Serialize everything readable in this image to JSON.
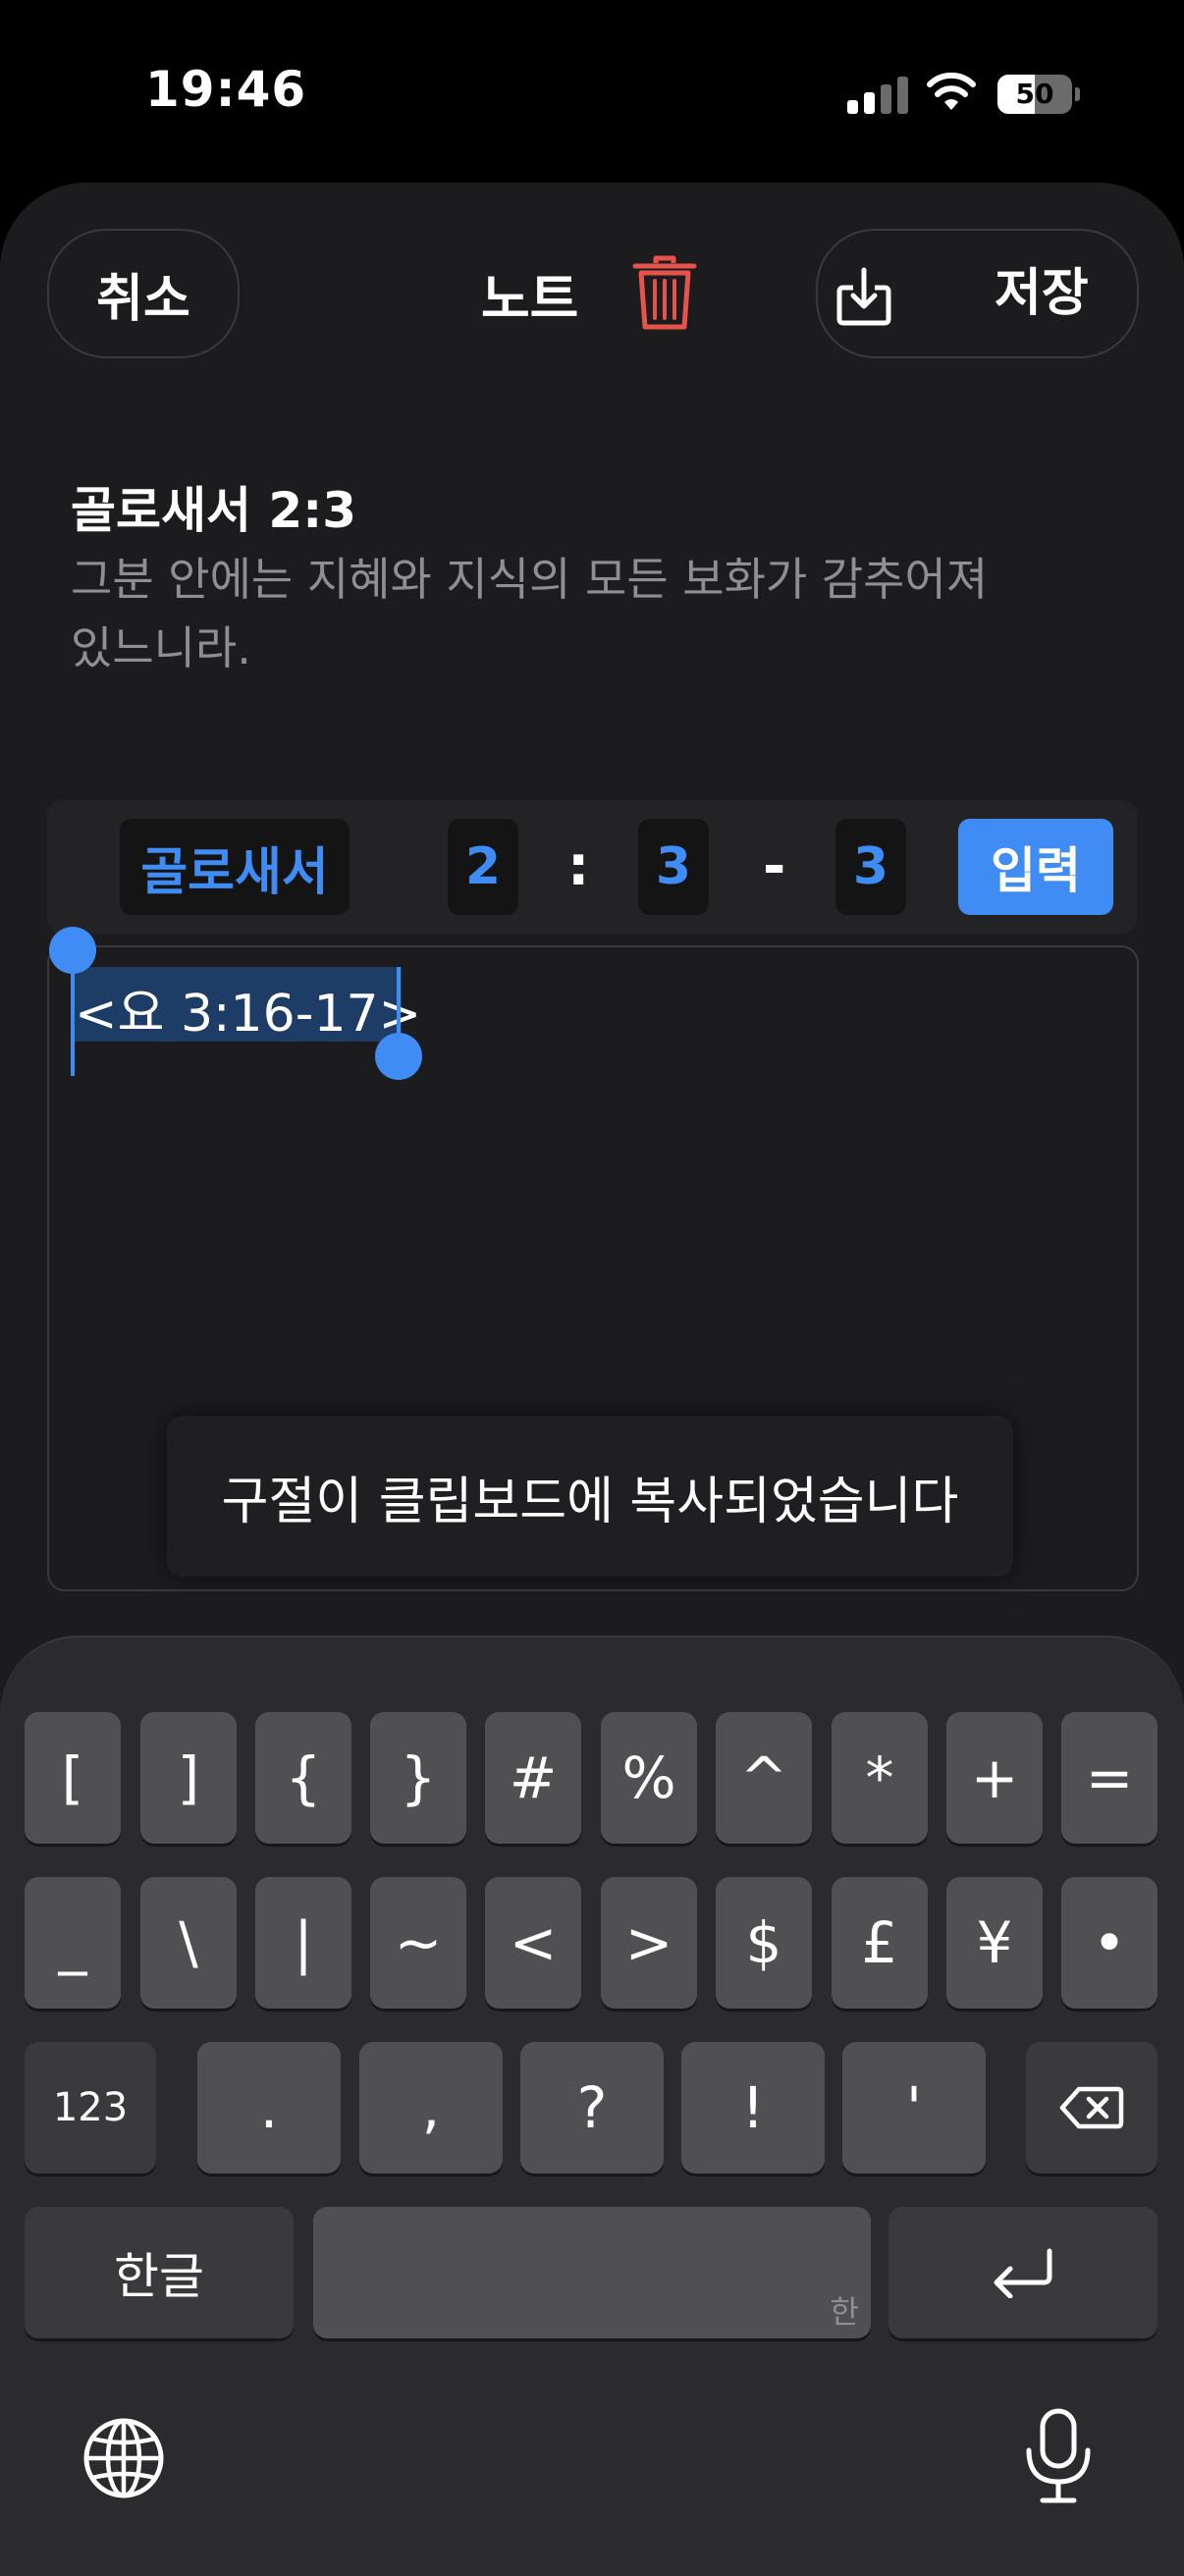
{
  "status_bar": {
    "time": "19:46",
    "battery_level": "50",
    "battery_fraction": 0.5
  },
  "header": {
    "cancel_label": "취소",
    "title": "노트",
    "save_label": "저장"
  },
  "verse": {
    "reference": "골로새서 2:3",
    "text": "그분 안에는 지혜와 지식의 모든 보화가 감추어져 있느니라."
  },
  "reference_bar": {
    "book": "골로새서",
    "chapter": "2",
    "sep_colon": ":",
    "verse_start": "3",
    "sep_dash": "-",
    "verse_end": "3",
    "enter_label": "입력"
  },
  "editor": {
    "selected_text": "<요 3:16-17>"
  },
  "toast": {
    "message": "구절이 클립보드에 복사되었습니다"
  },
  "keyboard": {
    "row1": [
      "[",
      "]",
      "{",
      "}",
      "#",
      "%",
      "^",
      "*",
      "+",
      "="
    ],
    "row2": [
      "_",
      "\\",
      "|",
      "~",
      "<",
      ">",
      "$",
      "£",
      "¥",
      "•"
    ],
    "row3": [
      "123",
      ".",
      ",",
      "?",
      "!",
      "'"
    ],
    "row4": {
      "lang_label": "한글",
      "space_hint": "한"
    }
  },
  "colors": {
    "accent": "#3f8cf5",
    "danger": "#e5534b",
    "background": "#1c1c1e"
  }
}
